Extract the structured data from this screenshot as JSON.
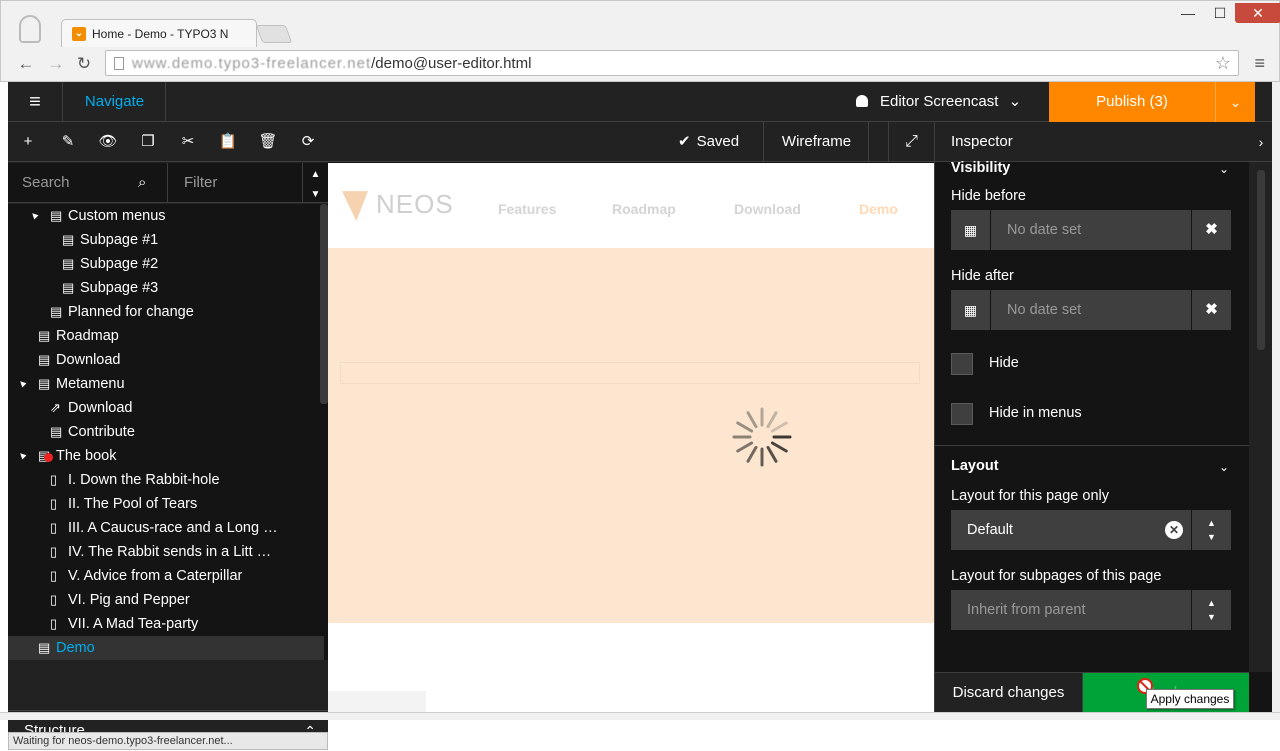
{
  "browser": {
    "tab_title": "Home - Demo - TYPO3 N",
    "url_host": "www.demo.typo3-freelancer.net",
    "url_path": "/demo@user-editor.html",
    "window_min": "—",
    "window_max": "☐",
    "window_close": "✕",
    "back_icon": "←",
    "forward_icon": "→",
    "reload_icon": "↻",
    "star_icon": "☆",
    "menu_icon": "≡"
  },
  "topbar": {
    "menu_icon": "≡",
    "navigate_label": "Navigate",
    "user_label": "Editor Screencast",
    "publish_label": "Publish (3)",
    "publish_dropdown_icon": "⌄"
  },
  "toolbar": {
    "add": "+",
    "edit": "✎",
    "hide": "👁",
    "copy": "❐",
    "cut": "✂",
    "paste": "📋",
    "delete": "🗑",
    "refresh": "⟳"
  },
  "search": {
    "placeholder": "Search",
    "filter_placeholder": "Filter"
  },
  "tree": [
    {
      "label": "Custom menus",
      "level": 1,
      "icon": "page",
      "toggle": "▲"
    },
    {
      "label": "Subpage #1",
      "level": 2,
      "icon": "page"
    },
    {
      "label": "Subpage #2",
      "level": 2,
      "icon": "page"
    },
    {
      "label": "Subpage #3",
      "level": 2,
      "icon": "page"
    },
    {
      "label": "Planned for change",
      "level": 1,
      "icon": "page"
    },
    {
      "label": "Roadmap",
      "level": 0,
      "icon": "page"
    },
    {
      "label": "Download",
      "level": 0,
      "icon": "page"
    },
    {
      "label": "Metamenu",
      "level": 0,
      "icon": "page",
      "toggle": "▲"
    },
    {
      "label": "Download",
      "level": 1,
      "icon": "shortcut"
    },
    {
      "label": "Contribute",
      "level": 1,
      "icon": "page"
    },
    {
      "label": "The book",
      "level": 0,
      "icon": "page-removed",
      "toggle": "▲"
    },
    {
      "label": "I. Down the Rabbit-hole",
      "level": 1,
      "icon": "book"
    },
    {
      "label": "II. The Pool of Tears",
      "level": 1,
      "icon": "book"
    },
    {
      "label": "III. A Caucus-race and a Long …",
      "level": 1,
      "icon": "book"
    },
    {
      "label": "IV. The Rabbit sends in a Litt …",
      "level": 1,
      "icon": "book"
    },
    {
      "label": "V. Advice from a Caterpillar",
      "level": 1,
      "icon": "book"
    },
    {
      "label": "VI. Pig and Pepper",
      "level": 1,
      "icon": "book"
    },
    {
      "label": "VII. A Mad Tea-party",
      "level": 1,
      "icon": "book"
    },
    {
      "label": "Demo",
      "level": 0,
      "icon": "page",
      "active": true
    }
  ],
  "structure_label": "Structure",
  "status_text": "Waiting for neos-demo.typo3-freelancer.net...",
  "content": {
    "saved_label": "Saved",
    "wireframe_label": "Wireframe",
    "fullscreen_icon": "⤢",
    "logo_text": "NEOS",
    "site_nav": [
      "Features",
      "Roadmap",
      "Download",
      "Demo"
    ],
    "hero_color": "#fde6cf"
  },
  "inspector": {
    "title": "Inspector",
    "visibility_heading": "Visibility",
    "hide_before_label": "Hide before",
    "hide_before_value": "No date set",
    "hide_after_label": "Hide after",
    "hide_after_value": "No date set",
    "hide_label": "Hide",
    "hide_in_menus_label": "Hide in menus",
    "layout_heading": "Layout",
    "layout_page_label": "Layout for this page only",
    "layout_page_value": "Default",
    "layout_sub_label": "Layout for subpages of this page",
    "layout_sub_value": "Inherit from parent",
    "discard_label": "Discard changes",
    "apply_label": "Apply",
    "apply_tooltip": "Apply changes"
  },
  "colors": {
    "accent_blue": "#00adee",
    "publish_orange": "#ff8700",
    "apply_green": "#00a338"
  }
}
